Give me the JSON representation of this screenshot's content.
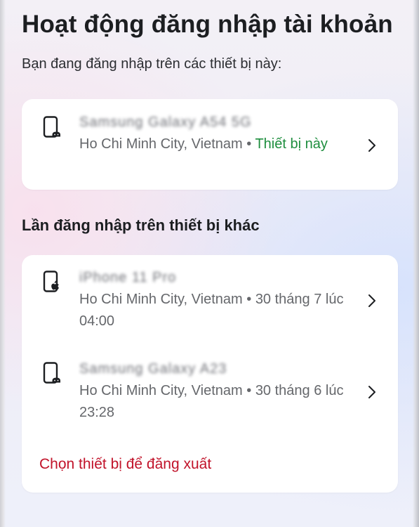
{
  "page": {
    "title": "Hoạt động đăng nhập tài khoản",
    "subtitle": "Bạn đang đăng nhập trên các thiết bị này:"
  },
  "current_session": {
    "device_name": "Samsung Galaxy A54 5G",
    "device_icon": "android-phone-icon",
    "location": "Ho Chi Minh City, Vietnam",
    "separator": " • ",
    "status": "Thiết bị này"
  },
  "other_sessions": {
    "heading": "Lần đăng nhập trên thiết bị khác",
    "items": [
      {
        "device_name": "iPhone 11 Pro",
        "device_icon": "apple-phone-icon",
        "location": "Ho Chi Minh City, Vietnam",
        "separator": " • ",
        "time": "30 tháng 7 lúc 04:00"
      },
      {
        "device_name": "Samsung Galaxy A23",
        "device_icon": "android-phone-icon",
        "location": "Ho Chi Minh City, Vietnam",
        "separator": " • ",
        "time": "30 tháng 6 lúc 23:28"
      }
    ],
    "logout_label": "Chọn thiết bị để đăng xuất"
  },
  "colors": {
    "status_green": "#1e8e3e",
    "danger_red": "#c1132a",
    "secondary_text": "#65676b"
  }
}
